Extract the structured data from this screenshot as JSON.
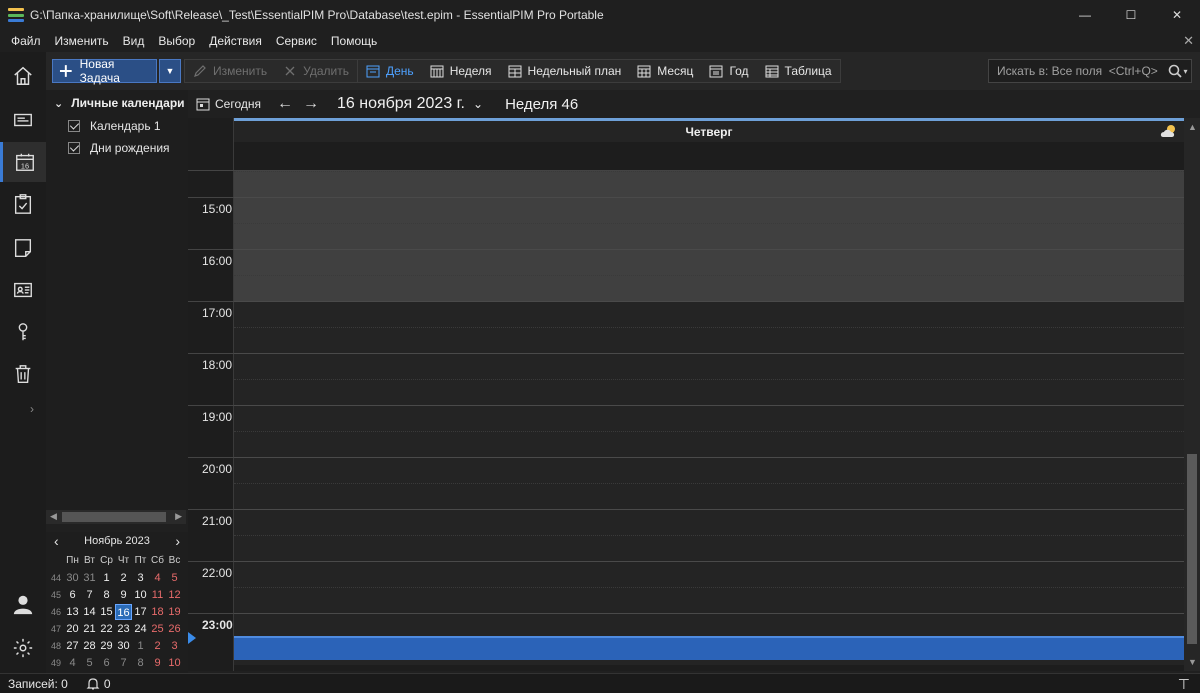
{
  "window": {
    "title": "G:\\Папка-хранилище\\Soft\\Release\\_Test\\EssentialPIM Pro\\Database\\test.epim - EssentialPIM Pro Portable",
    "minimize": "—",
    "maximize": "☐",
    "close": "✕",
    "logo_colors": [
      "#f2c14e",
      "#5bb85b",
      "#3a7bd5"
    ]
  },
  "menu": {
    "items": [
      "Файл",
      "Изменить",
      "Вид",
      "Выбор",
      "Действия",
      "Сервис",
      "Помощь"
    ],
    "close": "✕"
  },
  "sidebar": {
    "icons": [
      "home-icon",
      "mail-icon",
      "calendar-icon",
      "tasks-icon",
      "notes-icon",
      "contacts-icon",
      "passwords-icon",
      "trash-icon",
      "user-icon",
      "settings-icon"
    ],
    "calendar_badge": "16",
    "expand": "›"
  },
  "toolbar": {
    "new_task": "Новая Задача",
    "new_task_drop": "▼",
    "edit": "Изменить",
    "delete": "Удалить",
    "views": [
      "День",
      "Неделя",
      "Недельный план",
      "Месяц",
      "Год",
      "Таблица"
    ],
    "selected_view": "День",
    "search_placeholder": "Искать в: Все поля  <Ctrl+Q>",
    "search_drop": "▾"
  },
  "calendars": {
    "group": "Личные календари",
    "group_chevron": "⌄",
    "items": [
      "Календарь 1",
      "Дни рождения"
    ]
  },
  "minical": {
    "month": "Ноябрь  2023",
    "prev": "‹",
    "next": "›",
    "headers": [
      "Пн",
      "Вт",
      "Ср",
      "Чт",
      "Пт",
      "Сб",
      "Вс"
    ],
    "weeks": [
      {
        "wk": "44",
        "days": [
          "30",
          "31",
          "1",
          "2",
          "3",
          "4",
          "5"
        ]
      },
      {
        "wk": "45",
        "days": [
          "6",
          "7",
          "8",
          "9",
          "10",
          "11",
          "12"
        ]
      },
      {
        "wk": "46",
        "days": [
          "13",
          "14",
          "15",
          "16",
          "17",
          "18",
          "19"
        ]
      },
      {
        "wk": "47",
        "days": [
          "20",
          "21",
          "22",
          "23",
          "24",
          "25",
          "26"
        ]
      },
      {
        "wk": "48",
        "days": [
          "27",
          "28",
          "29",
          "30",
          "1",
          "2",
          "3"
        ]
      },
      {
        "wk": "49",
        "days": [
          "4",
          "5",
          "6",
          "7",
          "8",
          "9",
          "10"
        ]
      }
    ],
    "today": "16",
    "weekend_color": "#e86b6b"
  },
  "nav": {
    "today": "Сегодня",
    "back": "←",
    "forward": "→",
    "date": "16 ноября 2023 г.",
    "date_chevron": "⌄",
    "week": "Неделя 46"
  },
  "dayview": {
    "day_name": "Четверг",
    "hours": [
      "15:00",
      "16:00",
      "17:00",
      "18:00",
      "19:00",
      "20:00",
      "21:00",
      "22:00",
      "23:00"
    ],
    "current_hour": "23:00",
    "work_color": "#404040",
    "accent_color": "#2b63b8"
  },
  "status": {
    "records": "Записей: 0",
    "alerts": "0"
  }
}
